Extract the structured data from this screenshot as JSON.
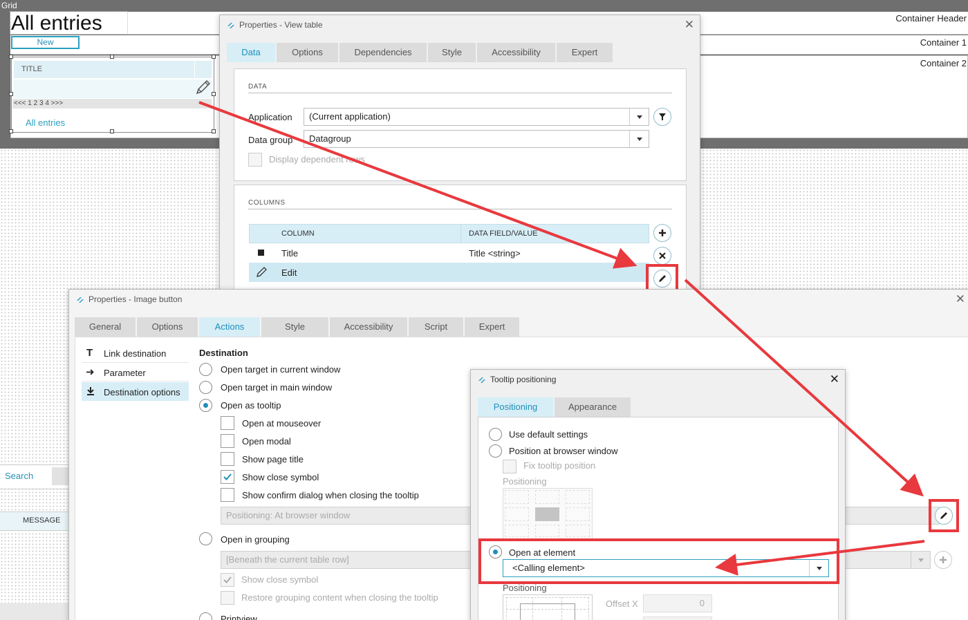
{
  "canvas": {
    "grid_label": "Grid",
    "page_title": "All entries",
    "container_header": "Container Header",
    "container1": "Container 1",
    "container2": "Container 2",
    "new_button": "New",
    "table_title_col": "TITLE",
    "pager": "<<< 1 2 3 4 >>>",
    "all_entries_link": "All entries",
    "search_tab": "Search",
    "message_col": "MESSAGE"
  },
  "view_table_dialog": {
    "title": "Properties - View table",
    "tabs": [
      "Data",
      "Options",
      "Dependencies",
      "Style",
      "Accessibility",
      "Expert"
    ],
    "active_tab": "Data",
    "data_section": "DATA",
    "application_label": "Application",
    "application_value": "(Current application)",
    "datagroup_label": "Data group",
    "datagroup_value": "Datagroup",
    "display_dependent": "Display dependent rows",
    "columns_section": "COLUMNS",
    "col_header_column": "COLUMN",
    "col_header_field": "DATA FIELD/VALUE",
    "rows": [
      {
        "column": "Title",
        "field": "Title <string>"
      },
      {
        "column": "Edit",
        "field": ""
      }
    ]
  },
  "image_button_dialog": {
    "title": "Properties - Image button",
    "tabs": [
      "General",
      "Options",
      "Actions",
      "Style",
      "Accessibility",
      "Script",
      "Expert"
    ],
    "active_tab": "Actions",
    "side_items": [
      "Link destination",
      "Parameter",
      "Destination options"
    ],
    "selected_side_item": "Destination options",
    "destination_heading": "Destination",
    "options": {
      "current_window": "Open target in current window",
      "main_window": "Open target in main window",
      "tooltip": "Open as tooltip",
      "mouseover": "Open at mouseover",
      "modal": "Open modal",
      "page_title": "Show page title",
      "close_symbol": "Show close symbol",
      "confirm": "Show confirm dialog when closing the tooltip",
      "positioning_value": "Positioning: At browser window",
      "grouping": "Open in grouping",
      "grouping_value": "[Beneath the current table row]",
      "grouping_close": "Show close symbol",
      "restore": "Restore grouping content when closing the tooltip",
      "printview": "Printview"
    }
  },
  "tooltip_dialog": {
    "title": "Tooltip positioning",
    "tabs": [
      "Positioning",
      "Appearance"
    ],
    "active_tab": "Positioning",
    "default_settings": "Use default settings",
    "browser_window": "Position at browser window",
    "fix_position": "Fix tooltip position",
    "positioning_label": "Positioning",
    "open_at_element": "Open at element",
    "calling_element": "<Calling element>",
    "positioning_label2": "Positioning",
    "offset_x_label": "Offset X",
    "offset_x_value": "0"
  },
  "colors": {
    "accent": "#1f8fb8",
    "annotation_red": "#e8393e"
  }
}
